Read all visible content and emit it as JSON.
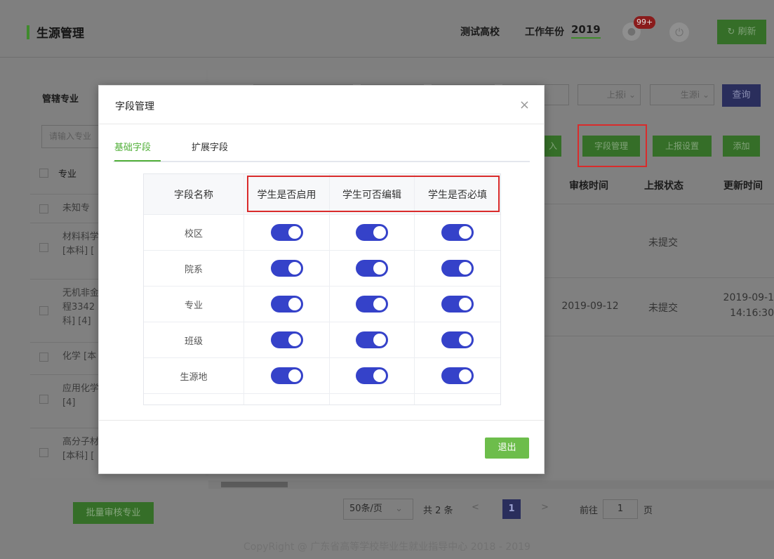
{
  "header": {
    "title": "生源管理",
    "school": "测试高校",
    "year_label": "工作年份",
    "year_value": "2019",
    "badge": "99+",
    "refresh_label": "刷新"
  },
  "sidebar": {
    "heading": "管辖专业",
    "search_placeholder": "请输入专业",
    "column_label": "专业",
    "rows": [
      "未知专",
      "材料科学\n[本科] [",
      "无机非金属\n程3342\n科] [4]",
      "化学 [本",
      "应用化学\n[4]",
      "高分子材\n[本科] ["
    ],
    "batch_button": "批量审核专业"
  },
  "filters": {
    "report_select": "上报i",
    "source_select": "生源i",
    "query_button": "查询"
  },
  "actions": {
    "import_label": "导入",
    "field_manage": "字段管理",
    "report_settings": "上报设置",
    "add": "添加"
  },
  "table": {
    "columns": [
      "审核时间",
      "上报状态",
      "更新时间"
    ],
    "rows": [
      {
        "review_time": "",
        "status": "未提交",
        "updated": ""
      },
      {
        "review_time": "2019-09-12",
        "status": "未提交",
        "updated": "2019-09-1\n14:16:30"
      }
    ]
  },
  "pagination": {
    "page_size": "50条/页",
    "total": "共 2 条",
    "current_page": "1",
    "goto_label": "前往",
    "goto_value": "1",
    "goto_suffix": "页"
  },
  "footer": {
    "copyright": "CopyRight @ 广东省高等学校毕业生就业指导中心 2018 - 2019"
  },
  "modal": {
    "title": "字段管理",
    "close": "×",
    "tabs": [
      "基础字段",
      "扩展字段"
    ],
    "active_tab": "基础字段",
    "columns": [
      "字段名称",
      "学生是否启用",
      "学生可否编辑",
      "学生是否必填"
    ],
    "fields": [
      {
        "name": "校区",
        "enabled": true,
        "editable": true,
        "required": true
      },
      {
        "name": "院系",
        "enabled": true,
        "editable": true,
        "required": true
      },
      {
        "name": "专业",
        "enabled": true,
        "editable": true,
        "required": true
      },
      {
        "name": "班级",
        "enabled": true,
        "editable": true,
        "required": true
      },
      {
        "name": "生源地",
        "enabled": true,
        "editable": true,
        "required": true
      }
    ],
    "exit_button": "退出",
    "toggle_on_color": "#3542c9"
  }
}
